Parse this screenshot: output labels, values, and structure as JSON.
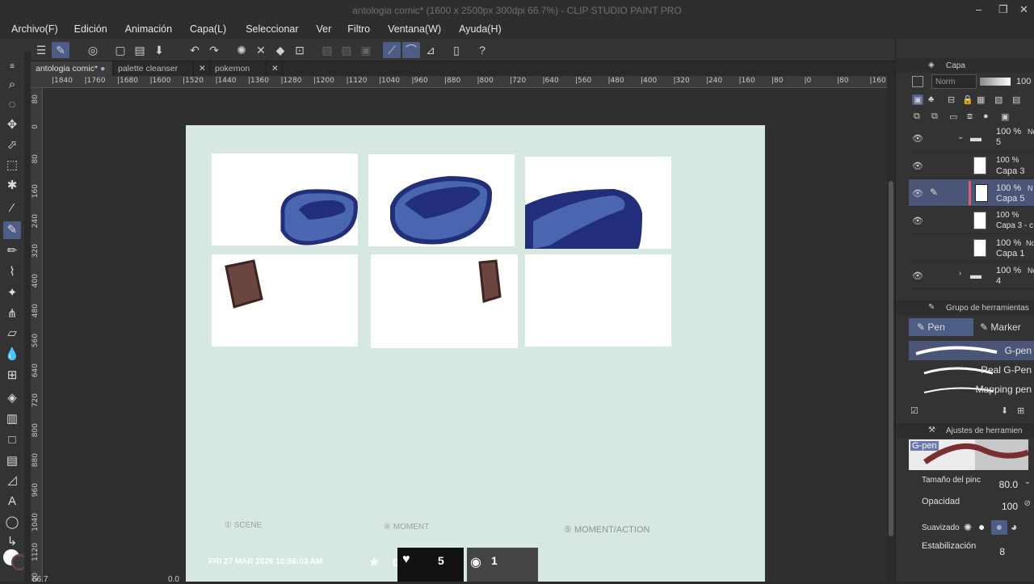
{
  "window": {
    "title": "antologia comic* (1600 x 2500px 300dpi 66.7%)  - CLIP STUDIO PAINT PRO",
    "controls": [
      "–",
      "❐",
      "✕"
    ]
  },
  "menu": [
    "Archivo(F)",
    "Edición",
    "Animación",
    "Capa(L)",
    "Seleccionar",
    "Ver",
    "Filtro",
    "Ventana(W)",
    "Ayuda(H)"
  ],
  "tabs": [
    {
      "label": "antologia comic*",
      "active": true
    },
    {
      "label": "palette cleanser",
      "active": false
    },
    {
      "label": "pokemon",
      "active": false
    }
  ],
  "ruler_top": [
    "1840",
    "1760",
    "1680",
    "1600",
    "1520",
    "1440",
    "1360",
    "1280",
    "1200",
    "1120",
    "1040",
    "960",
    "880",
    "800",
    "720",
    "640",
    "560",
    "480",
    "400",
    "320",
    "240",
    "160",
    "80",
    "0",
    "80",
    "160",
    "240"
  ],
  "ruler_left": [
    "80",
    "0",
    "80",
    "160",
    "240",
    "320",
    "400",
    "480",
    "560",
    "640",
    "720",
    "800",
    "880",
    "960",
    "1040",
    "1120",
    "1200"
  ],
  "layers_panel": {
    "title": "Capa",
    "blend": "Norm",
    "opacity": "100",
    "layers": [
      {
        "pct": "100 %",
        "mode": "No",
        "name": "5",
        "folder": true
      },
      {
        "pct": "100 %",
        "mode": "",
        "name": "Capa 3"
      },
      {
        "pct": "100 %",
        "mode": "N",
        "name": "Capa 5",
        "selected": true
      },
      {
        "pct": "100 %",
        "mode": "",
        "name": "Capa 3 - c"
      },
      {
        "pct": "100 %",
        "mode": "No",
        "name": "Capa 1"
      },
      {
        "pct": "100 %",
        "mode": "No",
        "name": "4",
        "folder": true
      }
    ],
    "more": "100 %"
  },
  "tool_group": {
    "title": "Grupo de herramientas",
    "tabs": [
      "Pen",
      "Marker"
    ],
    "brushes": [
      "G-pen",
      "Real G-Pen",
      "Mapping pen"
    ]
  },
  "tool_settings": {
    "title": "Ajustes de herramien",
    "preview_label": "G-pen",
    "brush_size_label": "Tamaño del pinc",
    "brush_size": "80.0",
    "opacity_label": "Opacidad",
    "opacity": "100",
    "smoothing_label": "Suavizado",
    "stabilization_label": "Estabilización",
    "stabilization": "8"
  },
  "canvas": {
    "sketch_labels": [
      "① SCENE",
      "④ MOMENT",
      "⑤ MOMENT/ACTION"
    ]
  },
  "overlay": {
    "timestamp": "FRI 27 MAR 2026 10:56:03 AM",
    "stars": "0",
    "likes": "5",
    "views": "1"
  },
  "status": {
    "zoom": "66.7",
    "angle": "0.0"
  },
  "colors": {
    "accent": "#4e5d84",
    "canvas_bg": "#d6e8df",
    "blue_dark": "#232e7a",
    "blue_light": "#4a66b0",
    "brown": "#6b4540"
  }
}
